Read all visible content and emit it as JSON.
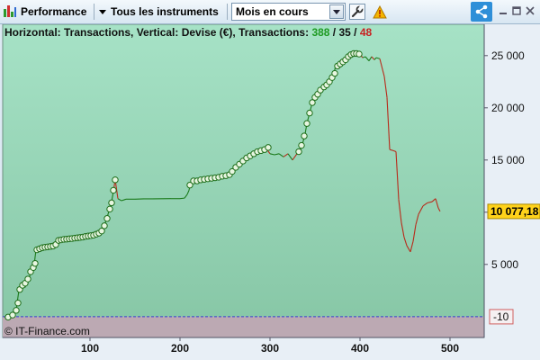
{
  "toolbar": {
    "performance_label": "Performance",
    "instruments_label": "Tous les instruments",
    "period_selected": "Mois en cours",
    "icons": [
      "bar-chart-icon",
      "chevron-down-icon",
      "wrench-icon",
      "warning-icon",
      "share-icon",
      "minimize-icon",
      "maximize-icon",
      "close-icon"
    ]
  },
  "header": {
    "prefix": "Horizontal: Transactions, Vertical: Devise (€), Transactions: ",
    "total": "388",
    "sep1": " / ",
    "neutral": "35",
    "sep2": " / ",
    "losing": "48"
  },
  "watermark": "© IT-Finance.com",
  "colors": {
    "plot_top": "#a6e2c6",
    "plot_bottom": "#86c6a5",
    "negative_zone": "#bca9b3",
    "gain_line": "#1a7a1a",
    "loss_line": "#b82a1a",
    "marker_fill": "#e8f6e1",
    "marker_stroke": "#1e6e1a",
    "zero_line": "#3a3ad0",
    "last_value_bg": "#ffd21a",
    "ref_value_border": "#d06060"
  },
  "chart_data": {
    "type": "line",
    "xlabel": "",
    "ylabel": "",
    "xlim": [
      3,
      538
    ],
    "ylim": [
      -2000,
      28000
    ],
    "x_ticks": [
      100,
      200,
      300,
      400,
      500
    ],
    "y_ticks": [
      5000,
      10000,
      15000,
      20000,
      25000
    ],
    "x_tick_labels": [
      "100",
      "200",
      "300",
      "400",
      "500"
    ],
    "y_tick_labels": [
      "5 000",
      "10 000",
      "15 000",
      "20 000",
      "25 000"
    ],
    "zero_value": -10,
    "zero_label": "-10",
    "last_value_label": "10 077,18",
    "grid": false,
    "equity_points": [
      [
        5,
        -30
      ],
      [
        9,
        -100
      ],
      [
        12,
        -10
      ],
      [
        15,
        200
      ],
      [
        18,
        600
      ],
      [
        19,
        1300
      ],
      [
        21,
        2500
      ],
      [
        24,
        2900
      ],
      [
        26,
        3100
      ],
      [
        28,
        2800
      ],
      [
        30,
        3400
      ],
      [
        33,
        3900
      ],
      [
        36,
        4600
      ],
      [
        38,
        5000
      ],
      [
        40,
        6400
      ],
      [
        45,
        6600
      ],
      [
        50,
        6650
      ],
      [
        55,
        6700
      ],
      [
        60,
        6800
      ],
      [
        65,
        7300
      ],
      [
        70,
        7400
      ],
      [
        75,
        7450
      ],
      [
        80,
        7500
      ],
      [
        85,
        7550
      ],
      [
        90,
        7600
      ],
      [
        95,
        7700
      ],
      [
        100,
        7750
      ],
      [
        105,
        7800
      ],
      [
        110,
        8000
      ],
      [
        112,
        8100
      ],
      [
        115,
        8600
      ],
      [
        118,
        9200
      ],
      [
        121,
        10100
      ],
      [
        124,
        11000
      ],
      [
        126,
        12000
      ],
      [
        128,
        13100
      ],
      [
        131,
        11300
      ],
      [
        135,
        11100
      ],
      [
        140,
        11250
      ],
      [
        150,
        11250
      ],
      [
        160,
        11280
      ],
      [
        170,
        11280
      ],
      [
        180,
        11290
      ],
      [
        190,
        11300
      ],
      [
        200,
        11300
      ],
      [
        205,
        11350
      ],
      [
        208,
        11700
      ],
      [
        210,
        12100
      ],
      [
        212,
        12900
      ],
      [
        215,
        13000
      ],
      [
        220,
        13000
      ],
      [
        225,
        13100
      ],
      [
        230,
        13200
      ],
      [
        235,
        13250
      ],
      [
        240,
        13300
      ],
      [
        245,
        13400
      ],
      [
        250,
        13500
      ],
      [
        255,
        13600
      ],
      [
        258,
        14000
      ],
      [
        262,
        14300
      ],
      [
        266,
        14700
      ],
      [
        270,
        15000
      ],
      [
        275,
        15300
      ],
      [
        280,
        15500
      ],
      [
        285,
        15800
      ],
      [
        290,
        16000
      ],
      [
        295,
        16200
      ],
      [
        300,
        15600
      ],
      [
        305,
        15500
      ],
      [
        310,
        15600
      ],
      [
        315,
        15300
      ],
      [
        320,
        15600
      ],
      [
        325,
        15000
      ],
      [
        330,
        15600
      ],
      [
        333,
        15800
      ],
      [
        336,
        16500
      ],
      [
        339,
        17500
      ],
      [
        341,
        18500
      ],
      [
        344,
        19500
      ],
      [
        347,
        20500
      ],
      [
        350,
        21000
      ],
      [
        353,
        21500
      ],
      [
        356,
        21700
      ],
      [
        360,
        22000
      ],
      [
        365,
        22500
      ],
      [
        370,
        23000
      ],
      [
        373,
        24000
      ],
      [
        378,
        24200
      ],
      [
        383,
        24600
      ],
      [
        388,
        25000
      ],
      [
        392,
        25200
      ],
      [
        396,
        25200
      ],
      [
        400,
        25100
      ],
      [
        403,
        24800
      ],
      [
        406,
        24900
      ],
      [
        410,
        24500
      ],
      [
        413,
        24900
      ],
      [
        416,
        24600
      ],
      [
        418,
        24800
      ],
      [
        422,
        24700
      ],
      [
        427,
        23000
      ],
      [
        430,
        21000
      ],
      [
        433,
        16000
      ],
      [
        437,
        15900
      ],
      [
        440,
        15800
      ],
      [
        443,
        11200
      ],
      [
        446,
        9000
      ],
      [
        449,
        7600
      ],
      [
        452,
        6800
      ],
      [
        456,
        6200
      ],
      [
        459,
        7200
      ],
      [
        462,
        8800
      ],
      [
        465,
        9800
      ],
      [
        470,
        10600
      ],
      [
        475,
        10900
      ],
      [
        480,
        11000
      ],
      [
        484,
        11300
      ],
      [
        487,
        10400
      ],
      [
        489,
        10077
      ]
    ],
    "loss_segments": [
      [
        126,
        131
      ],
      [
        295,
        300
      ],
      [
        315,
        320
      ],
      [
        325,
        330
      ],
      [
        400,
        403
      ],
      [
        413,
        416
      ],
      [
        422,
        489
      ]
    ],
    "transaction_markers": [
      [
        9,
        -50
      ],
      [
        14,
        150
      ],
      [
        18,
        600
      ],
      [
        20,
        1300
      ],
      [
        22,
        2600
      ],
      [
        25,
        3000
      ],
      [
        28,
        3200
      ],
      [
        31,
        3600
      ],
      [
        34,
        4300
      ],
      [
        37,
        4700
      ],
      [
        39,
        5100
      ],
      [
        41,
        6400
      ],
      [
        44,
        6500
      ],
      [
        47,
        6600
      ],
      [
        50,
        6650
      ],
      [
        53,
        6680
      ],
      [
        56,
        6720
      ],
      [
        59,
        6760
      ],
      [
        62,
        6900
      ],
      [
        65,
        7300
      ],
      [
        68,
        7350
      ],
      [
        71,
        7400
      ],
      [
        74,
        7420
      ],
      [
        77,
        7450
      ],
      [
        80,
        7480
      ],
      [
        83,
        7520
      ],
      [
        86,
        7550
      ],
      [
        89,
        7580
      ],
      [
        92,
        7620
      ],
      [
        95,
        7680
      ],
      [
        98,
        7720
      ],
      [
        101,
        7760
      ],
      [
        104,
        7800
      ],
      [
        107,
        7900
      ],
      [
        110,
        8000
      ],
      [
        113,
        8200
      ],
      [
        116,
        8700
      ],
      [
        119,
        9400
      ],
      [
        122,
        10300
      ],
      [
        124,
        10900
      ],
      [
        126,
        12100
      ],
      [
        128,
        13100
      ],
      [
        211,
        12600
      ],
      [
        215,
        13000
      ],
      [
        219,
        13000
      ],
      [
        223,
        13100
      ],
      [
        227,
        13150
      ],
      [
        231,
        13200
      ],
      [
        235,
        13250
      ],
      [
        239,
        13300
      ],
      [
        243,
        13350
      ],
      [
        247,
        13450
      ],
      [
        251,
        13500
      ],
      [
        255,
        13600
      ],
      [
        258,
        13900
      ],
      [
        262,
        14300
      ],
      [
        266,
        14600
      ],
      [
        270,
        14900
      ],
      [
        274,
        15200
      ],
      [
        278,
        15400
      ],
      [
        282,
        15600
      ],
      [
        286,
        15800
      ],
      [
        290,
        15900
      ],
      [
        294,
        16000
      ],
      [
        298,
        16200
      ],
      [
        332,
        15800
      ],
      [
        335,
        16400
      ],
      [
        338,
        17300
      ],
      [
        341,
        18500
      ],
      [
        344,
        19500
      ],
      [
        347,
        20500
      ],
      [
        350,
        21000
      ],
      [
        353,
        21300
      ],
      [
        356,
        21700
      ],
      [
        360,
        22000
      ],
      [
        363,
        22200
      ],
      [
        366,
        22500
      ],
      [
        369,
        22900
      ],
      [
        372,
        23300
      ],
      [
        375,
        24000
      ],
      [
        378,
        24200
      ],
      [
        381,
        24400
      ],
      [
        384,
        24600
      ],
      [
        387,
        24900
      ],
      [
        390,
        25100
      ],
      [
        393,
        25200
      ],
      [
        396,
        25200
      ],
      [
        399,
        25150
      ]
    ]
  }
}
